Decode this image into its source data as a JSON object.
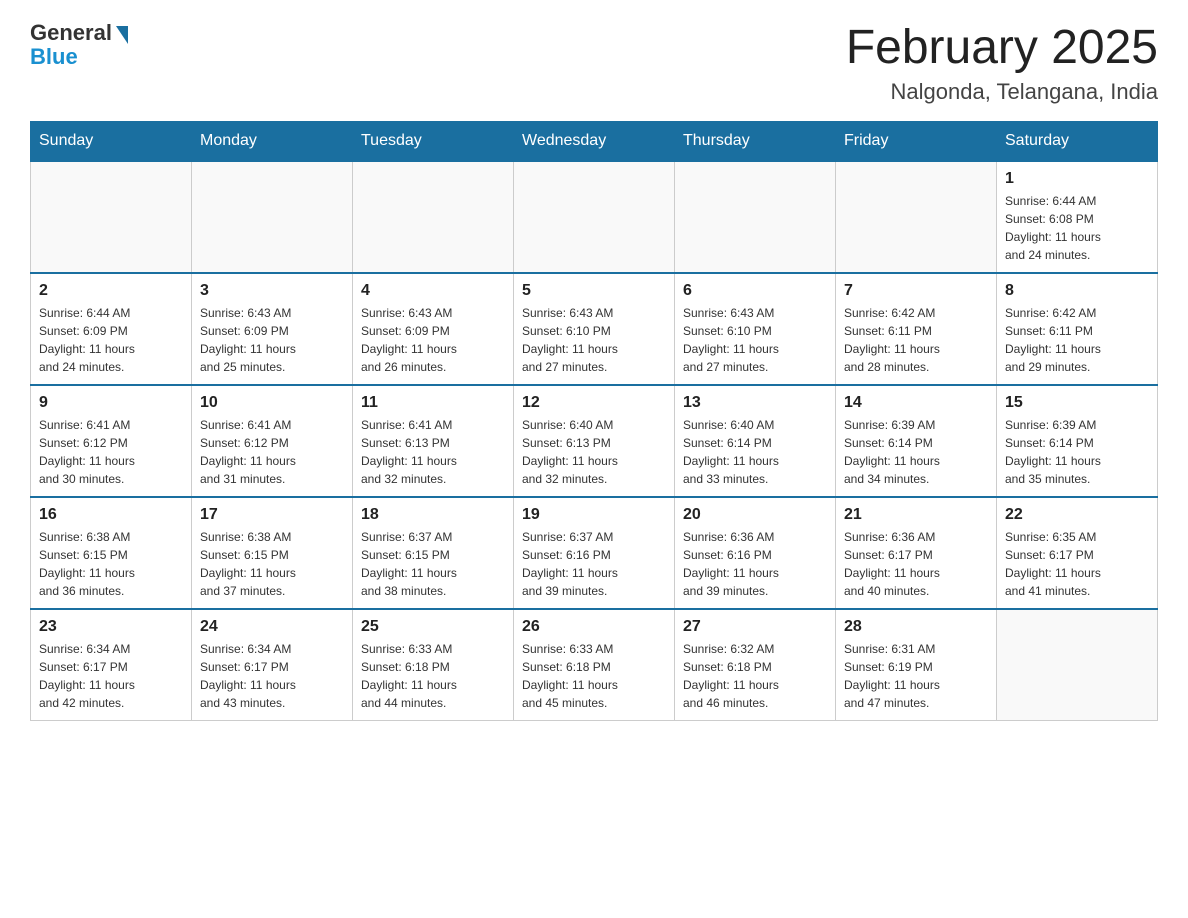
{
  "logo": {
    "general": "General",
    "blue": "Blue"
  },
  "header": {
    "month_title": "February 2025",
    "location": "Nalgonda, Telangana, India"
  },
  "days_of_week": [
    "Sunday",
    "Monday",
    "Tuesday",
    "Wednesday",
    "Thursday",
    "Friday",
    "Saturday"
  ],
  "weeks": [
    [
      {
        "day": "",
        "info": ""
      },
      {
        "day": "",
        "info": ""
      },
      {
        "day": "",
        "info": ""
      },
      {
        "day": "",
        "info": ""
      },
      {
        "day": "",
        "info": ""
      },
      {
        "day": "",
        "info": ""
      },
      {
        "day": "1",
        "info": "Sunrise: 6:44 AM\nSunset: 6:08 PM\nDaylight: 11 hours\nand 24 minutes."
      }
    ],
    [
      {
        "day": "2",
        "info": "Sunrise: 6:44 AM\nSunset: 6:09 PM\nDaylight: 11 hours\nand 24 minutes."
      },
      {
        "day": "3",
        "info": "Sunrise: 6:43 AM\nSunset: 6:09 PM\nDaylight: 11 hours\nand 25 minutes."
      },
      {
        "day": "4",
        "info": "Sunrise: 6:43 AM\nSunset: 6:09 PM\nDaylight: 11 hours\nand 26 minutes."
      },
      {
        "day": "5",
        "info": "Sunrise: 6:43 AM\nSunset: 6:10 PM\nDaylight: 11 hours\nand 27 minutes."
      },
      {
        "day": "6",
        "info": "Sunrise: 6:43 AM\nSunset: 6:10 PM\nDaylight: 11 hours\nand 27 minutes."
      },
      {
        "day": "7",
        "info": "Sunrise: 6:42 AM\nSunset: 6:11 PM\nDaylight: 11 hours\nand 28 minutes."
      },
      {
        "day": "8",
        "info": "Sunrise: 6:42 AM\nSunset: 6:11 PM\nDaylight: 11 hours\nand 29 minutes."
      }
    ],
    [
      {
        "day": "9",
        "info": "Sunrise: 6:41 AM\nSunset: 6:12 PM\nDaylight: 11 hours\nand 30 minutes."
      },
      {
        "day": "10",
        "info": "Sunrise: 6:41 AM\nSunset: 6:12 PM\nDaylight: 11 hours\nand 31 minutes."
      },
      {
        "day": "11",
        "info": "Sunrise: 6:41 AM\nSunset: 6:13 PM\nDaylight: 11 hours\nand 32 minutes."
      },
      {
        "day": "12",
        "info": "Sunrise: 6:40 AM\nSunset: 6:13 PM\nDaylight: 11 hours\nand 32 minutes."
      },
      {
        "day": "13",
        "info": "Sunrise: 6:40 AM\nSunset: 6:14 PM\nDaylight: 11 hours\nand 33 minutes."
      },
      {
        "day": "14",
        "info": "Sunrise: 6:39 AM\nSunset: 6:14 PM\nDaylight: 11 hours\nand 34 minutes."
      },
      {
        "day": "15",
        "info": "Sunrise: 6:39 AM\nSunset: 6:14 PM\nDaylight: 11 hours\nand 35 minutes."
      }
    ],
    [
      {
        "day": "16",
        "info": "Sunrise: 6:38 AM\nSunset: 6:15 PM\nDaylight: 11 hours\nand 36 minutes."
      },
      {
        "day": "17",
        "info": "Sunrise: 6:38 AM\nSunset: 6:15 PM\nDaylight: 11 hours\nand 37 minutes."
      },
      {
        "day": "18",
        "info": "Sunrise: 6:37 AM\nSunset: 6:15 PM\nDaylight: 11 hours\nand 38 minutes."
      },
      {
        "day": "19",
        "info": "Sunrise: 6:37 AM\nSunset: 6:16 PM\nDaylight: 11 hours\nand 39 minutes."
      },
      {
        "day": "20",
        "info": "Sunrise: 6:36 AM\nSunset: 6:16 PM\nDaylight: 11 hours\nand 39 minutes."
      },
      {
        "day": "21",
        "info": "Sunrise: 6:36 AM\nSunset: 6:17 PM\nDaylight: 11 hours\nand 40 minutes."
      },
      {
        "day": "22",
        "info": "Sunrise: 6:35 AM\nSunset: 6:17 PM\nDaylight: 11 hours\nand 41 minutes."
      }
    ],
    [
      {
        "day": "23",
        "info": "Sunrise: 6:34 AM\nSunset: 6:17 PM\nDaylight: 11 hours\nand 42 minutes."
      },
      {
        "day": "24",
        "info": "Sunrise: 6:34 AM\nSunset: 6:17 PM\nDaylight: 11 hours\nand 43 minutes."
      },
      {
        "day": "25",
        "info": "Sunrise: 6:33 AM\nSunset: 6:18 PM\nDaylight: 11 hours\nand 44 minutes."
      },
      {
        "day": "26",
        "info": "Sunrise: 6:33 AM\nSunset: 6:18 PM\nDaylight: 11 hours\nand 45 minutes."
      },
      {
        "day": "27",
        "info": "Sunrise: 6:32 AM\nSunset: 6:18 PM\nDaylight: 11 hours\nand 46 minutes."
      },
      {
        "day": "28",
        "info": "Sunrise: 6:31 AM\nSunset: 6:19 PM\nDaylight: 11 hours\nand 47 minutes."
      },
      {
        "day": "",
        "info": ""
      }
    ]
  ]
}
